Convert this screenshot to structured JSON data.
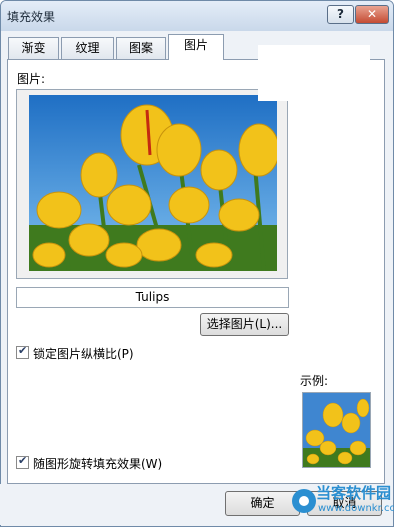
{
  "window": {
    "title": "填充效果",
    "help": "?",
    "close": "✕"
  },
  "tabs": [
    {
      "label": "渐变",
      "active": false
    },
    {
      "label": "纹理",
      "active": false
    },
    {
      "label": "图案",
      "active": false
    },
    {
      "label": "图片",
      "active": true
    }
  ],
  "picture": {
    "section_label": "图片:",
    "file_name": "Tulips",
    "select_button": "选择图片(L)..."
  },
  "options": {
    "lock_aspect": {
      "label": "锁定图片纵横比(P)",
      "checked": true
    },
    "rotate_with_shape": {
      "label": "随图形旋转填充效果(W)",
      "checked": true
    }
  },
  "sample": {
    "label": "示例:"
  },
  "buttons": {
    "ok": "确定",
    "cancel": "取消"
  },
  "watermark": {
    "title": "当客软件园",
    "url": "www.downkr.com"
  },
  "colors": {
    "sky": "#2f86d8",
    "tulip": "#f2c21a",
    "stem": "#3f7a1e"
  }
}
